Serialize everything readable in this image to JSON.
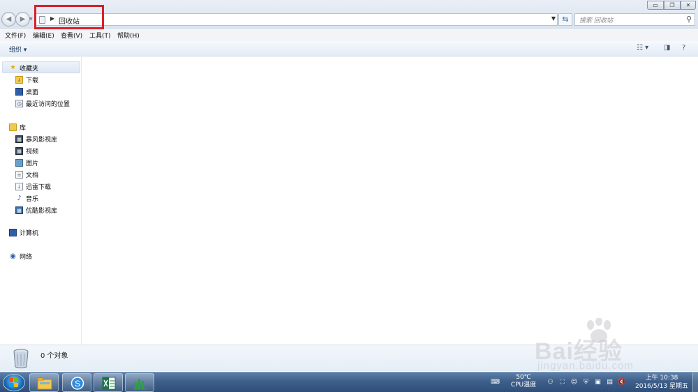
{
  "window": {
    "address": {
      "location": "回收站"
    },
    "search": {
      "placeholder": "搜索 回收站"
    }
  },
  "menu": {
    "items": [
      {
        "label": "文件(F)"
      },
      {
        "label": "编辑(E)"
      },
      {
        "label": "查看(V)"
      },
      {
        "label": "工具(T)"
      },
      {
        "label": "帮助(H)"
      }
    ]
  },
  "toolbar": {
    "organize_label": "组织 ▾"
  },
  "nav": {
    "favorites": {
      "label": "收藏夹",
      "items": [
        {
          "label": "下载",
          "icon": "download-folder-icon"
        },
        {
          "label": "桌面",
          "icon": "desktop-icon"
        },
        {
          "label": "最近访问的位置",
          "icon": "recent-places-icon"
        }
      ]
    },
    "libraries": {
      "label": "库",
      "items": [
        {
          "label": "暴风影视库",
          "icon": "video-library-icon"
        },
        {
          "label": "视频",
          "icon": "video-icon"
        },
        {
          "label": "图片",
          "icon": "picture-icon"
        },
        {
          "label": "文档",
          "icon": "document-icon"
        },
        {
          "label": "迅雷下载",
          "icon": "download-icon"
        },
        {
          "label": "音乐",
          "icon": "music-icon"
        },
        {
          "label": "优酷影视库",
          "icon": "video-library-icon"
        }
      ]
    },
    "computer": {
      "label": "计算机"
    },
    "network": {
      "label": "网络"
    }
  },
  "details": {
    "status": "0 个对象"
  },
  "watermark": {
    "main": "Bai经验",
    "sub": "jingyan.baidu.com"
  },
  "taskbar": {
    "cpu_temp": "50℃",
    "cpu_label": "CPU温度",
    "time": "上午 10:38",
    "date": "2016/5/13 星期五"
  },
  "colors": {
    "highlight": "#d8202a",
    "taskbar": "#3d5f8a",
    "accent": "#3a6ea8"
  }
}
